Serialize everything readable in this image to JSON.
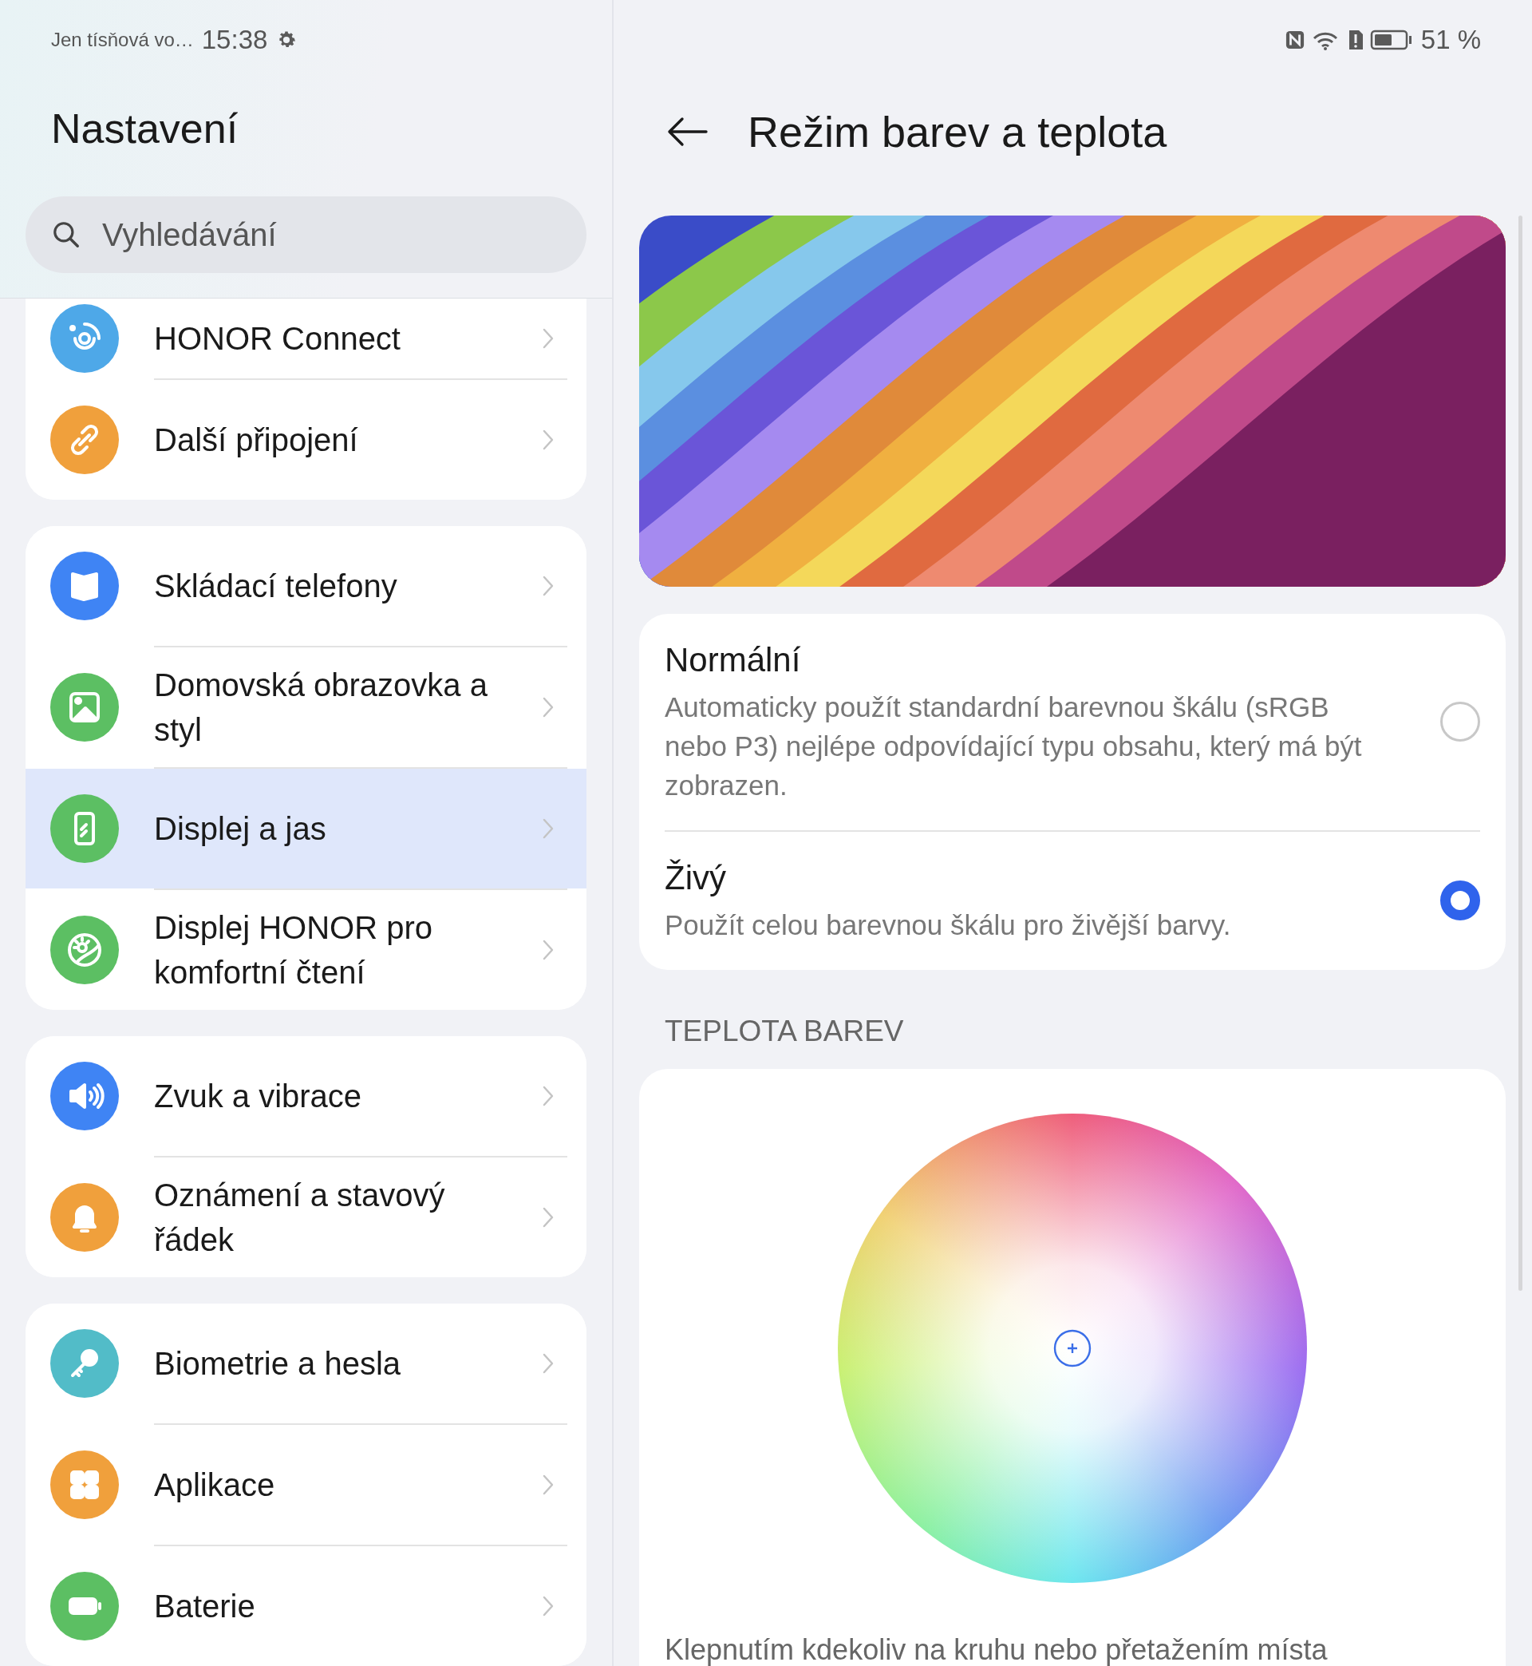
{
  "status_bar": {
    "carrier": "Jen tísňová vo…",
    "time": "15:38",
    "battery": "51 %"
  },
  "sidebar": {
    "title": "Nastavení",
    "search": {
      "placeholder": "Vyhledávání"
    },
    "groups": [
      {
        "items": [
          {
            "label": "HONOR Connect",
            "selected": false,
            "color": "#4ea8e8"
          },
          {
            "label": "Další připojení",
            "selected": false,
            "color": "#f0a03c"
          }
        ]
      },
      {
        "items": [
          {
            "label": "Skládací telefony",
            "selected": false,
            "color": "#3f84f4"
          },
          {
            "label": "Domovská obrazovka a styl",
            "selected": false,
            "color": "#5cbf63"
          },
          {
            "label": "Displej a jas",
            "selected": true,
            "color": "#5cbf63"
          },
          {
            "label": "Displej HONOR pro komfortní čtení",
            "selected": false,
            "color": "#5cbf63"
          }
        ]
      },
      {
        "items": [
          {
            "label": "Zvuk a vibrace",
            "selected": false,
            "color": "#3f84f4"
          },
          {
            "label": "Oznámení a stavový řádek",
            "selected": false,
            "color": "#f0a03c"
          }
        ]
      },
      {
        "items": [
          {
            "label": "Biometrie a hesla",
            "selected": false,
            "color": "#52bcc8"
          },
          {
            "label": "Aplikace",
            "selected": false,
            "color": "#f0a03c"
          },
          {
            "label": "Baterie",
            "selected": false,
            "color": "#5cbf63"
          }
        ]
      }
    ]
  },
  "detail": {
    "title": "Režim barev a teplota",
    "modes": [
      {
        "title": "Normální",
        "description": "Automaticky použít standardní barevnou škálu (sRGB nebo P3) nejlépe odpovídající typu obsahu, který má být zobrazen.",
        "selected": false
      },
      {
        "title": "Živý",
        "description": "Použít celou barevnou škálu pro živější barvy.",
        "selected": true
      }
    ],
    "section_title": "TEPLOTA BAREV",
    "wheel_hint": "Klepnutím kdekoliv na kruhu nebo přetažením místa"
  }
}
